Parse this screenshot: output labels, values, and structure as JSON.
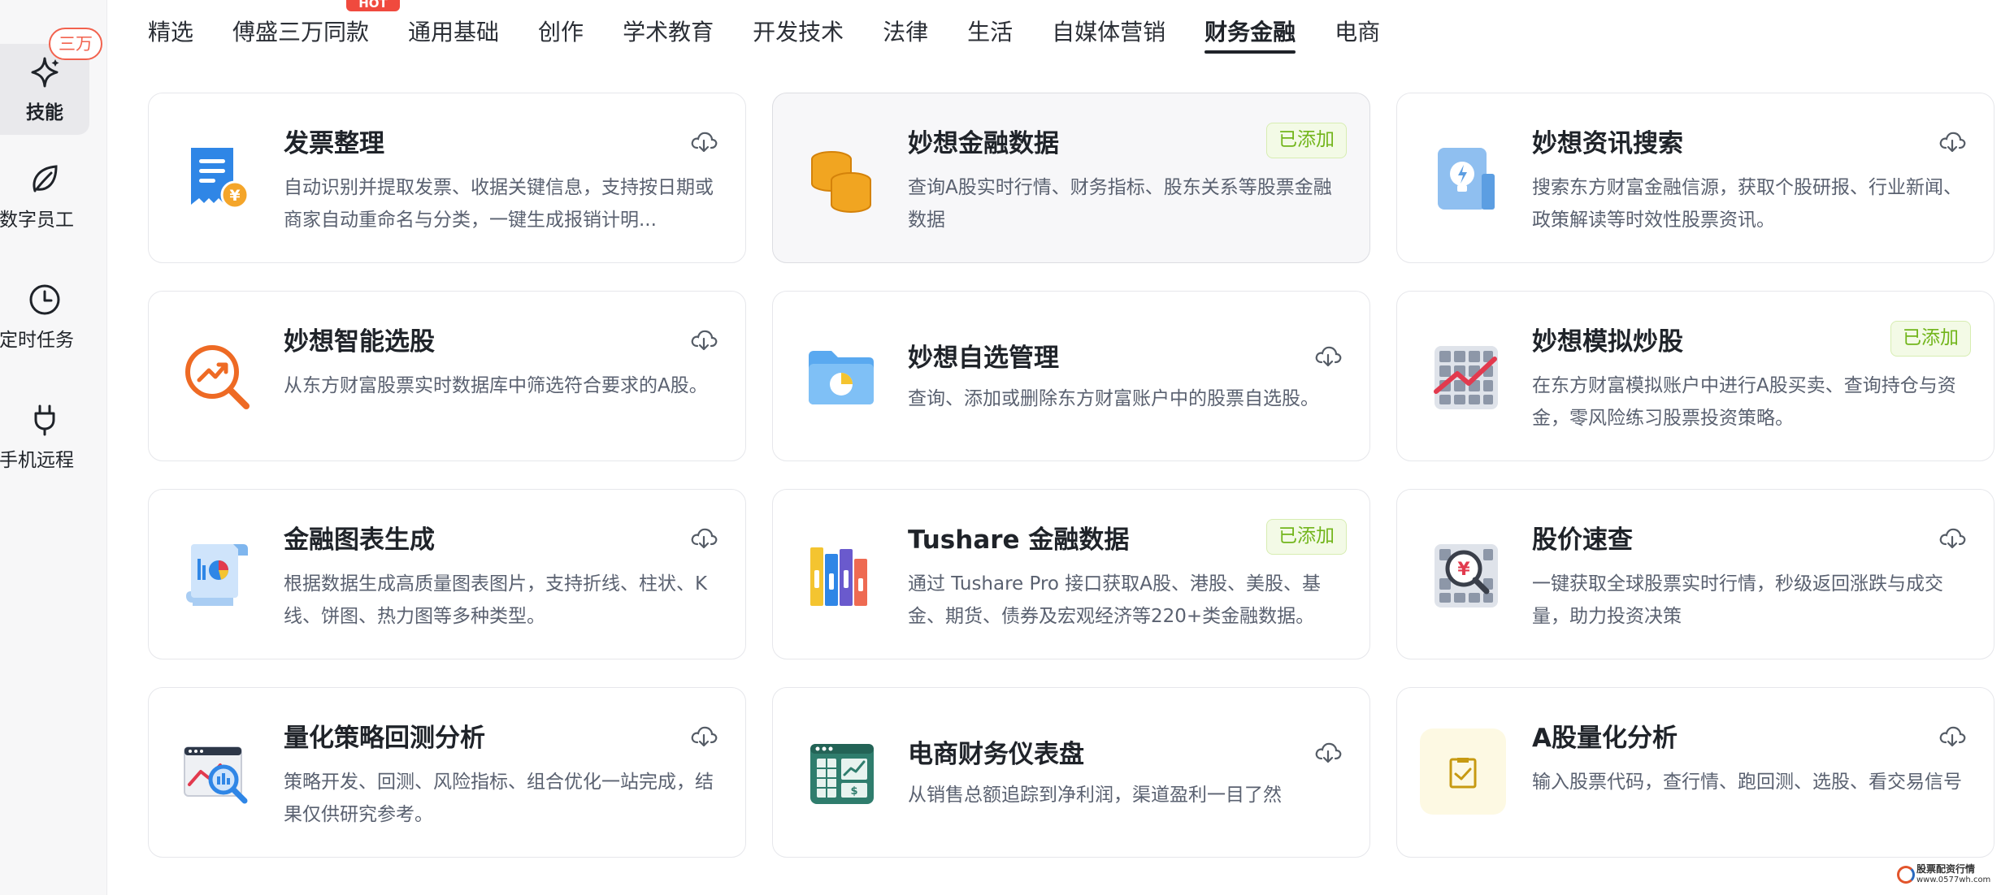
{
  "sidebar": {
    "items": [
      {
        "label": "技能",
        "icon": "sparkle-icon",
        "badge": "三万",
        "active": true
      },
      {
        "label": "数字员工",
        "icon": "leaf-icon"
      },
      {
        "label": "定时任务",
        "icon": "clock-icon"
      },
      {
        "label": "手机远程",
        "icon": "plug-icon"
      }
    ]
  },
  "tabs": {
    "hot_label": "HOT",
    "items": [
      {
        "label": "精选"
      },
      {
        "label": "傅盛三万同款"
      },
      {
        "label": "通用基础"
      },
      {
        "label": "创作"
      },
      {
        "label": "学术教育"
      },
      {
        "label": "开发技术"
      },
      {
        "label": "法律"
      },
      {
        "label": "生活"
      },
      {
        "label": "自媒体营销"
      },
      {
        "label": "财务金融",
        "active": true
      },
      {
        "label": "电商"
      }
    ]
  },
  "cards": [
    {
      "title": "发票整理",
      "desc": "自动识别并提取发票、收据关键信息，支持按日期或商家自动重命名与分类，一键生成报销计明...",
      "icon": "invoice-icon",
      "status": "download"
    },
    {
      "title": "妙想金融数据",
      "desc": "查询A股实时行情、财务指标、股东关系等股票金融数据",
      "icon": "coins-icon",
      "status": "added"
    },
    {
      "title": "妙想资讯搜索",
      "desc": "搜索东方财富金融信源，获取个股研报、行业新闻、政策解读等时效性股票资讯。",
      "icon": "lightbulb-card-icon",
      "status": "download"
    },
    {
      "title": "妙想智能选股",
      "desc": "从东方财富股票实时数据库中筛选符合要求的A股。",
      "icon": "trend-magnifier-icon",
      "status": "download"
    },
    {
      "title": "妙想自选管理",
      "desc": "查询、添加或删除东方财富账户中的股票自选股。",
      "icon": "folder-chart-icon",
      "status": "download"
    },
    {
      "title": "妙想模拟炒股",
      "desc": "在东方财富模拟账户中进行A股买卖、查询持仓与资金，零风险练习股票投资策略。",
      "icon": "grid-chart-icon",
      "status": "added"
    },
    {
      "title": "金融图表生成",
      "desc": "根据数据生成高质量图表图片，支持折线、柱状、K线、饼图、热力图等多种类型。",
      "icon": "scroll-chart-icon",
      "status": "download"
    },
    {
      "title": "Tushare 金融数据",
      "desc": "通过 Tushare Pro 接口获取A股、港股、美股、基金、期货、债券及宏观经济等220+类金融数据。",
      "icon": "books-icon",
      "status": "added"
    },
    {
      "title": "股价速查",
      "desc": "一键获取全球股票实时行情，秒级返回涨跌与成交量，助力投资决策",
      "icon": "yuan-magnifier-icon",
      "status": "download"
    },
    {
      "title": "量化策略回测分析",
      "desc": "策略开发、回测、风险指标、组合优化一站完成，结果仅供研究参考。",
      "icon": "backtest-icon",
      "status": "download"
    },
    {
      "title": "电商财务仪表盘",
      "desc": "从销售总额追踪到净利润，渠道盈利一目了然",
      "icon": "dashboard-icon",
      "status": "download"
    },
    {
      "title": "A股量化分析",
      "desc": "输入股票代码，查行情、跑回测、选股、看交易信号",
      "icon": "checklist-icon",
      "status": "download"
    }
  ],
  "added_label": "已添加",
  "watermark": {
    "line1": "股票配资行情",
    "line2": "www.0577wh.com"
  }
}
